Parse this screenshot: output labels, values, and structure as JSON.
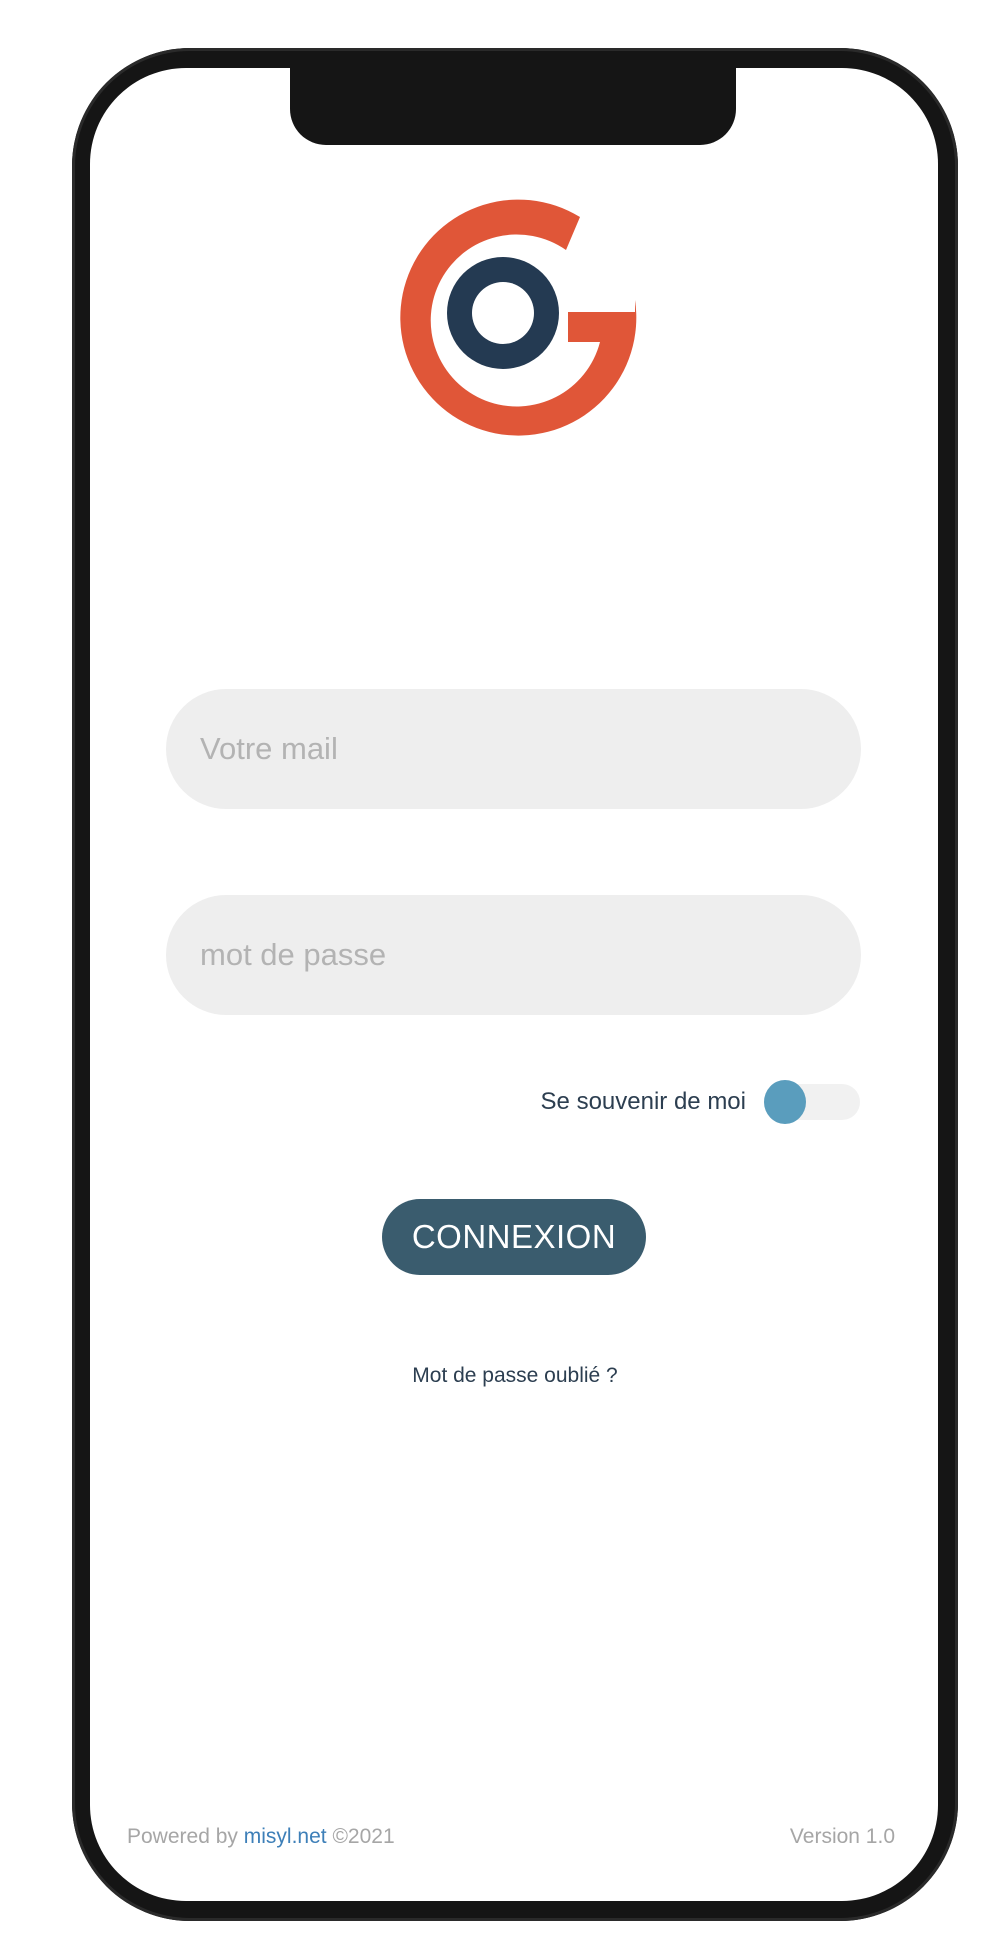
{
  "login": {
    "email_placeholder": "Votre mail",
    "password_placeholder": "mot de passe",
    "remember_label": "Se souvenir de moi",
    "remember_enabled": false,
    "submit_label": "CONNEXION",
    "forgot_label": "Mot de passe oublié ?"
  },
  "footer": {
    "powered_prefix": "Powered by",
    "powered_link": "misyl.net",
    "copyright": "©2021",
    "version": "Version 1.0"
  },
  "colors": {
    "logo_orange": "#e05638",
    "logo_navy": "#243a52",
    "button": "#3a5c6e",
    "toggle_knob": "#5a9dbd",
    "link": "#3d7fb8"
  },
  "icons": {
    "logo": "go-logo-icon"
  }
}
